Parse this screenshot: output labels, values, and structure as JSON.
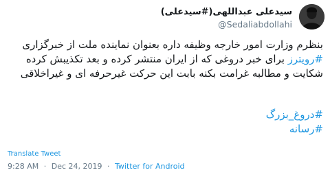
{
  "author": {
    "name": "سیدعلی عبداللهی(#سیدعلی)",
    "handle": "@Sedaliabdollahi"
  },
  "tweet": {
    "line1": "بنظرم وزارت امور خارجه وظیفه داره بعنوان نماینده ملت از خبرگزاری",
    "line2_hashtag": "#رویترز",
    "line2_rest": " برای خبر دروغی که از ایران منتشر کرده و بعد تکذیبش کرده",
    "line3": "شکایت و مطالبه غرامت بکنه بابت این حرکت غیرحرفه ای و غیراخلاقی",
    "hashtags": [
      "#دروغ_بزرگ",
      "#رسانه"
    ]
  },
  "translate_label": "Translate Tweet",
  "meta": {
    "time": "9:28 AM",
    "separator": "·",
    "date": "Dec 24, 2019",
    "source": "Twitter for Android"
  },
  "colors": {
    "link": "#1b95e0",
    "muted": "#657786",
    "text": "#14171a"
  }
}
